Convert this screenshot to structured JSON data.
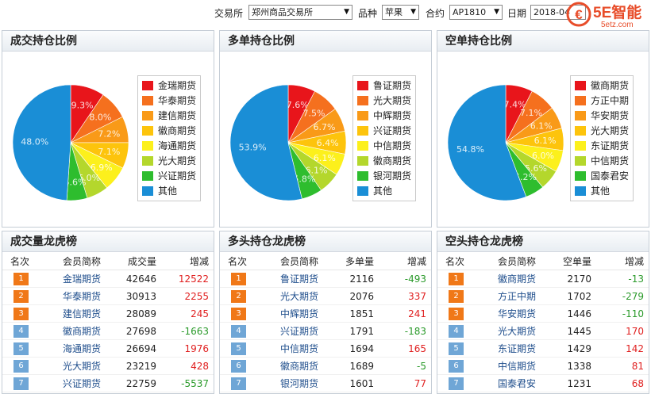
{
  "filters": {
    "exchange_label": "交易所",
    "exchange_value": "郑州商品交易所",
    "product_label": "品种",
    "product_value": "苹果",
    "contract_label": "合约",
    "contract_value": "AP1810",
    "date_label": "日期",
    "date_value": "2018-04"
  },
  "logo": {
    "brand": "5E智能",
    "domain": "5etz.com"
  },
  "colors": {
    "rank_top": "#f07818",
    "rank_other": "#6fa6d6",
    "increase": "#e02020",
    "decrease": "#2a9a2a",
    "pie": [
      "#e8151b",
      "#f5701e",
      "#f99a18",
      "#fdc40c",
      "#fcf01c",
      "#b4d72c",
      "#2ebd2e",
      "#1a8ed6"
    ]
  },
  "panels": {
    "volume_ratio_title": "成交持仓比例",
    "long_ratio_title": "多单持仓比例",
    "short_ratio_title": "空单持仓比例",
    "volume_rank_title": "成交量龙虎榜",
    "long_rank_title": "多头持仓龙虎榜",
    "short_rank_title": "空头持仓龙虎榜"
  },
  "chart_data": [
    {
      "type": "pie",
      "title": "成交持仓比例",
      "categories": [
        "金瑞期货",
        "华泰期货",
        "建信期货",
        "徽商期货",
        "海通期货",
        "光大期货",
        "兴证期货",
        "其他"
      ],
      "values": [
        9.3,
        8.0,
        7.2,
        7.1,
        6.9,
        6.0,
        5.6,
        48.0
      ],
      "labels": [
        "9.3%",
        "8.0%",
        "7.2%",
        "7.1%",
        "6.9%",
        "6.0%",
        "5.6%",
        "48.0%"
      ]
    },
    {
      "type": "pie",
      "title": "多单持仓比例",
      "categories": [
        "鲁证期货",
        "光大期货",
        "中辉期货",
        "兴证期货",
        "中信期货",
        "徽商期货",
        "银河期货",
        "其他"
      ],
      "values": [
        7.6,
        7.5,
        6.7,
        6.4,
        6.1,
        6.1,
        5.8,
        53.9
      ],
      "labels": [
        "7.6%",
        "7.5%",
        "6.7%",
        "6.4%",
        "6.1%",
        "6.1%",
        "5.8%",
        "53.9%"
      ]
    },
    {
      "type": "pie",
      "title": "空单持仓比例",
      "categories": [
        "徽商期货",
        "方正中期",
        "华安期货",
        "光大期货",
        "东证期货",
        "中信期货",
        "国泰君安",
        "其他"
      ],
      "values": [
        7.4,
        7.1,
        6.1,
        6.1,
        6.0,
        5.6,
        5.2,
        54.8
      ],
      "labels": [
        "7.4%",
        "7.1%",
        "6.1%",
        "6.1%",
        "6.0%",
        "5.6%",
        "5.2%",
        "54.8%"
      ]
    }
  ],
  "tables": {
    "volume": {
      "headers": [
        "名次",
        "会员简称",
        "成交量",
        "增减"
      ],
      "rows": [
        {
          "rank": "1",
          "member": "金瑞期货",
          "value": "42646",
          "change": "12522",
          "dir": "up"
        },
        {
          "rank": "2",
          "member": "华泰期货",
          "value": "30913",
          "change": "2255",
          "dir": "up"
        },
        {
          "rank": "3",
          "member": "建信期货",
          "value": "28089",
          "change": "245",
          "dir": "up"
        },
        {
          "rank": "4",
          "member": "徽商期货",
          "value": "27698",
          "change": "-1663",
          "dir": "down"
        },
        {
          "rank": "5",
          "member": "海通期货",
          "value": "26694",
          "change": "1976",
          "dir": "up"
        },
        {
          "rank": "6",
          "member": "光大期货",
          "value": "23219",
          "change": "428",
          "dir": "up"
        },
        {
          "rank": "7",
          "member": "兴证期货",
          "value": "22759",
          "change": "-5537",
          "dir": "down"
        }
      ]
    },
    "long": {
      "headers": [
        "名次",
        "会员简称",
        "多单量",
        "增减"
      ],
      "rows": [
        {
          "rank": "1",
          "member": "鲁证期货",
          "value": "2116",
          "change": "-493",
          "dir": "down"
        },
        {
          "rank": "2",
          "member": "光大期货",
          "value": "2076",
          "change": "337",
          "dir": "up"
        },
        {
          "rank": "3",
          "member": "中辉期货",
          "value": "1851",
          "change": "241",
          "dir": "up"
        },
        {
          "rank": "4",
          "member": "兴证期货",
          "value": "1791",
          "change": "-183",
          "dir": "down"
        },
        {
          "rank": "5",
          "member": "中信期货",
          "value": "1694",
          "change": "165",
          "dir": "up"
        },
        {
          "rank": "6",
          "member": "徽商期货",
          "value": "1689",
          "change": "-5",
          "dir": "down"
        },
        {
          "rank": "7",
          "member": "银河期货",
          "value": "1601",
          "change": "77",
          "dir": "up"
        }
      ]
    },
    "short": {
      "headers": [
        "名次",
        "会员简称",
        "空单量",
        "增减"
      ],
      "rows": [
        {
          "rank": "1",
          "member": "徽商期货",
          "value": "2170",
          "change": "-13",
          "dir": "down"
        },
        {
          "rank": "2",
          "member": "方正中期",
          "value": "1702",
          "change": "-279",
          "dir": "down"
        },
        {
          "rank": "3",
          "member": "华安期货",
          "value": "1446",
          "change": "-110",
          "dir": "down"
        },
        {
          "rank": "4",
          "member": "光大期货",
          "value": "1445",
          "change": "170",
          "dir": "up"
        },
        {
          "rank": "5",
          "member": "东证期货",
          "value": "1429",
          "change": "142",
          "dir": "up"
        },
        {
          "rank": "6",
          "member": "中信期货",
          "value": "1338",
          "change": "81",
          "dir": "up"
        },
        {
          "rank": "7",
          "member": "国泰君安",
          "value": "1231",
          "change": "68",
          "dir": "up"
        }
      ]
    }
  }
}
